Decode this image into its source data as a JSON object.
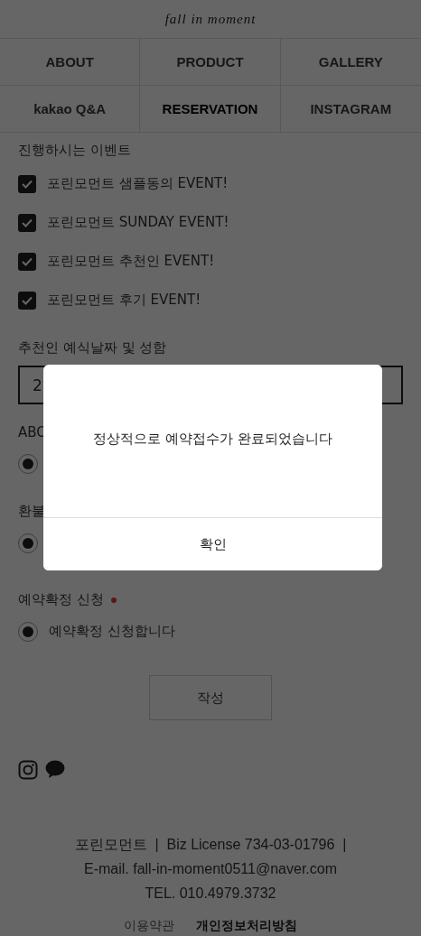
{
  "logo": "fall in moment",
  "nav": [
    {
      "label": "ABOUT",
      "selected": false
    },
    {
      "label": "PRODUCT",
      "selected": false
    },
    {
      "label": "GALLERY",
      "selected": false
    },
    {
      "label": "kakao Q&A",
      "selected": false
    },
    {
      "label": "RESERVATION",
      "selected": true
    },
    {
      "label": "INSTAGRAM",
      "selected": false
    }
  ],
  "events": {
    "label": "진행하시는 이벤트",
    "options": [
      {
        "label": "포린모먼트 샘플동의 EVENT!",
        "checked": true
      },
      {
        "label": "포린모먼트 SUNDAY EVENT!",
        "checked": true
      },
      {
        "label": "포린모먼트 추천인 EVENT!",
        "checked": true
      },
      {
        "label": "포린모먼트 후기 EVENT!",
        "checked": true
      }
    ]
  },
  "referral": {
    "label": "추천인 예식날짜 및 성함",
    "value": "2"
  },
  "radio_groups": [
    {
      "label": "ABC",
      "options": [
        {
          "selected": true
        }
      ]
    },
    {
      "label": "환불",
      "options": [
        {
          "selected": true
        }
      ]
    },
    {
      "label": "예약확정 신청",
      "required": true,
      "options": [
        {
          "label": "예약확정 신청합니다",
          "selected": true
        }
      ]
    }
  ],
  "submit": "작성",
  "footer": {
    "lines": [
      "포린모먼트  |  Biz License 734-03-01796  |",
      "E-mail. fall-in-moment0511@naver.com",
      "TEL. 010.4979.3732"
    ],
    "links": [
      {
        "label": "이용약관",
        "emphasized": false
      },
      {
        "label": "개인정보처리방침",
        "emphasized": true
      }
    ]
  },
  "dialog": {
    "message": "정상적으로 예약접수가 완료되었습니다",
    "button": "확인"
  }
}
